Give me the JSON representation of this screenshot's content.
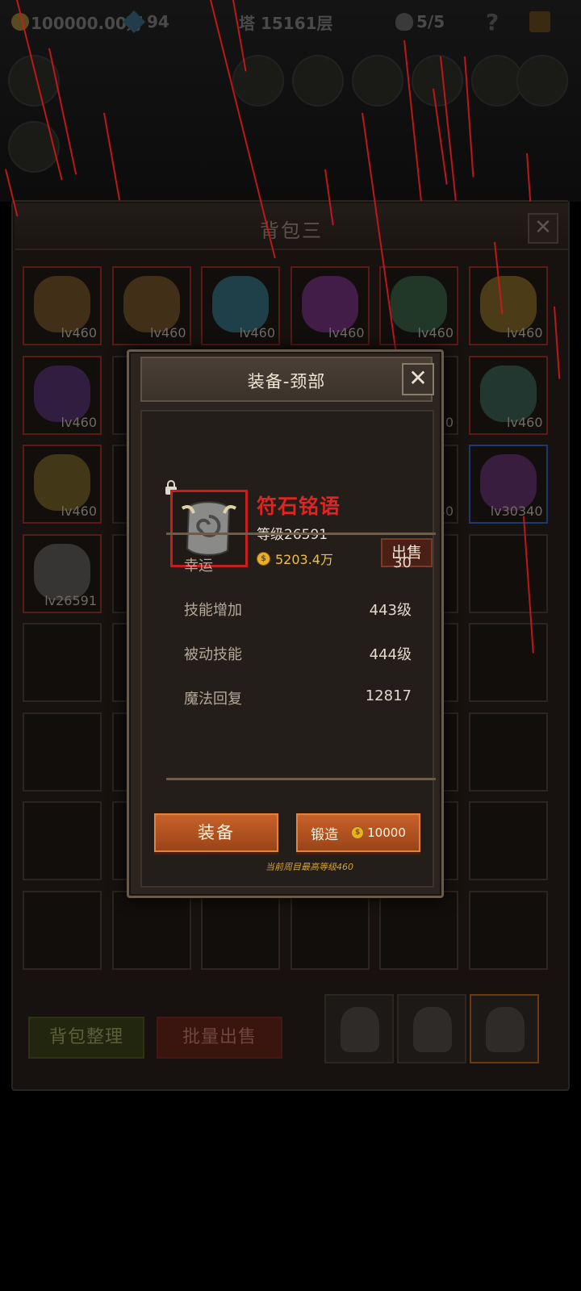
{
  "topbar": {
    "gold": "100000.00万",
    "gems": "94",
    "tower": "塔 15161层",
    "skulls": "5/5",
    "help": "?"
  },
  "backpack": {
    "title": "背包三",
    "close": "✕",
    "slots": [
      {
        "level": "lv460",
        "color": "#6a4a20"
      },
      {
        "level": "lv460",
        "color": "#6a4a20"
      },
      {
        "level": "lv460",
        "color": "#2a6a7a"
      },
      {
        "level": "lv460",
        "color": "#6a2a7a"
      },
      {
        "level": "lv460",
        "color": "#2e5a3e"
      },
      {
        "level": "lv460",
        "color": "#7a6020"
      },
      {
        "level": "lv460",
        "color": "#4a2a6a"
      },
      {
        "level": "",
        "color": ""
      },
      {
        "level": "",
        "color": ""
      },
      {
        "level": "",
        "color": ""
      },
      {
        "level": "0",
        "color": ""
      },
      {
        "level": "lv460",
        "color": "#2e5a4e"
      },
      {
        "level": "lv460",
        "color": "#6a5a20"
      },
      {
        "level": "",
        "color": ""
      },
      {
        "level": "",
        "color": ""
      },
      {
        "level": "",
        "color": ""
      },
      {
        "level": "40",
        "color": ""
      },
      {
        "level": "lv30340",
        "color": "#5a2a6a"
      },
      {
        "level": "lv26591",
        "color": "#555"
      }
    ],
    "arrange_label": "背包整理",
    "batch_sell_label": "批量出售"
  },
  "dialog": {
    "title": "装备-颈部",
    "close": "✕",
    "item": {
      "name": "符石铭语",
      "level": "等级26591",
      "price": "5203.4万",
      "coin_symbol": "$"
    },
    "sell_label": "出售",
    "stats": [
      {
        "key": "幸运",
        "value": "30"
      },
      {
        "key": "技能增加",
        "value": "443级"
      },
      {
        "key": "被动技能",
        "value": "444级"
      },
      {
        "key": "魔法回复",
        "value": "12817"
      }
    ],
    "equip_label": "装备",
    "forge_label": "锻造",
    "forge_cost": "10000",
    "hint": "当前周目最高等级460"
  },
  "colors": {
    "accent_orange": "#c8612a",
    "item_name_red": "#e02424",
    "gold": "#f0c040"
  }
}
